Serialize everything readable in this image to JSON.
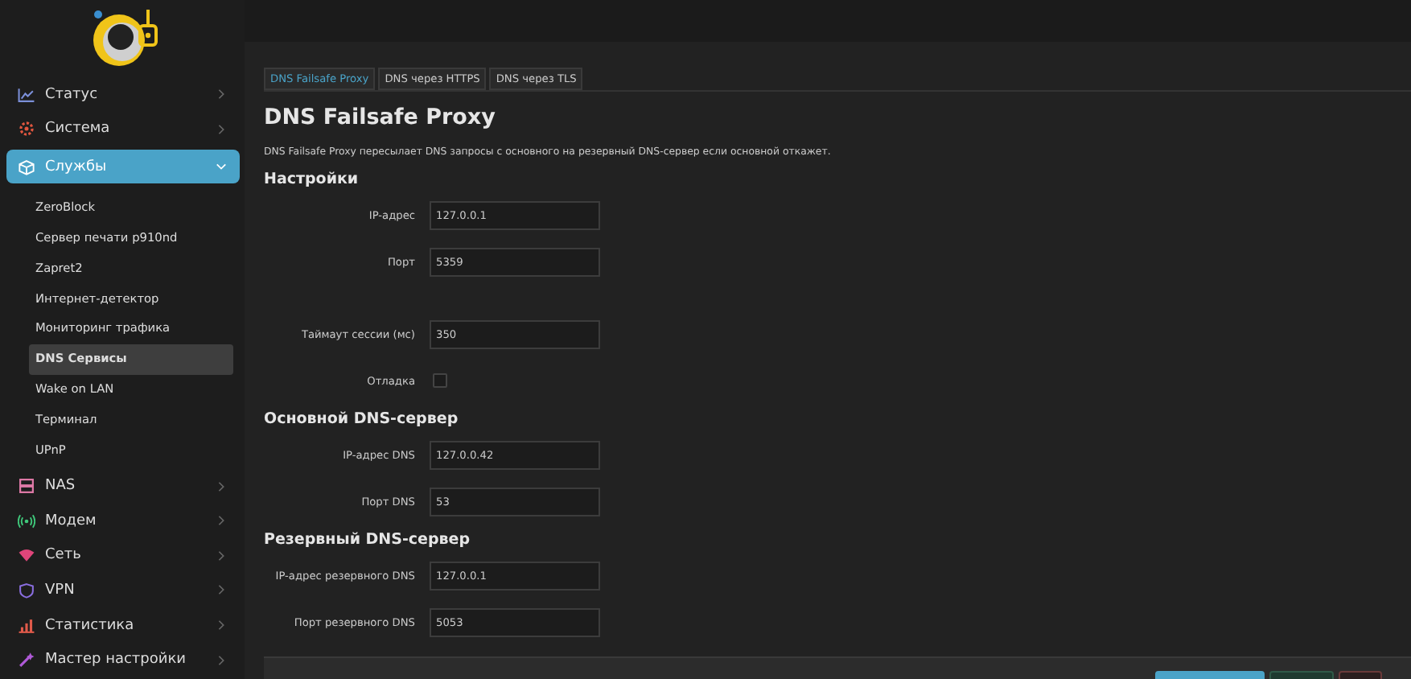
{
  "sidebar": {
    "items": [
      {
        "label": "Статус",
        "kind": "chart",
        "expanded": false,
        "selected": false
      },
      {
        "label": "Система",
        "kind": "gear",
        "expanded": false,
        "selected": false
      },
      {
        "label": "Службы",
        "kind": "cube",
        "expanded": true,
        "selected": true,
        "children": [
          {
            "label": "ZeroBlock",
            "selected": false
          },
          {
            "label": "Сервер печати p910nd",
            "selected": false
          },
          {
            "label": "Zapret2",
            "selected": false
          },
          {
            "label": "Интернет-детектор",
            "selected": false
          },
          {
            "label": "Мониторинг трафика",
            "selected": false
          },
          {
            "label": "DNS Сервисы",
            "selected": true
          },
          {
            "label": "Wake on LAN",
            "selected": false
          },
          {
            "label": "Терминал",
            "selected": false
          },
          {
            "label": "UPnP",
            "selected": false
          }
        ]
      },
      {
        "label": "NAS",
        "kind": "storage",
        "expanded": false,
        "selected": false
      },
      {
        "label": "Модем",
        "kind": "signal",
        "expanded": false,
        "selected": false
      },
      {
        "label": "Сеть",
        "kind": "wifi",
        "expanded": false,
        "selected": false
      },
      {
        "label": "VPN",
        "kind": "shield",
        "expanded": false,
        "selected": false
      },
      {
        "label": "Статистика",
        "kind": "bars",
        "expanded": false,
        "selected": false
      },
      {
        "label": "Мастер настройки",
        "kind": "wand",
        "expanded": false,
        "selected": false
      }
    ]
  },
  "tabs": [
    {
      "label": "DNS Failsafe Proxy",
      "selected": true
    },
    {
      "label": "DNS через HTTPS",
      "selected": false
    },
    {
      "label": "DNS через TLS",
      "selected": false
    }
  ],
  "page": {
    "title": "DNS Failsafe Proxy",
    "description": "DNS Failsafe Proxy пересылает DNS запросы с основного на резервный DNS-сервер если основной откажет."
  },
  "sections": [
    {
      "title": "Настройки",
      "fields": [
        {
          "kind": "text",
          "label": "IP-адрес",
          "value": "127.0.0.1"
        },
        {
          "kind": "text",
          "label": "Порт",
          "value": "5359"
        },
        {
          "kind": "text",
          "label": "Таймаут сессии (мс)",
          "value": "350"
        },
        {
          "kind": "checkbox",
          "label": "Отладка",
          "checked": false
        }
      ]
    },
    {
      "title": "Основной DNS-сервер",
      "fields": [
        {
          "kind": "text",
          "label": "IP-адрес DNS",
          "value": "127.0.0.42"
        },
        {
          "kind": "text",
          "label": "Порт DNS",
          "value": "53"
        }
      ]
    },
    {
      "title": "Резервный DNS-сервер",
      "fields": [
        {
          "kind": "text",
          "label": "IP-адрес резервного DNS",
          "value": "127.0.0.1"
        },
        {
          "kind": "text",
          "label": "Порт резервного DNS",
          "value": "5053"
        }
      ]
    }
  ],
  "footer": {
    "buttons": [
      {
        "kind": "primary"
      },
      {
        "kind": "secondary"
      },
      {
        "kind": "reset"
      }
    ]
  }
}
